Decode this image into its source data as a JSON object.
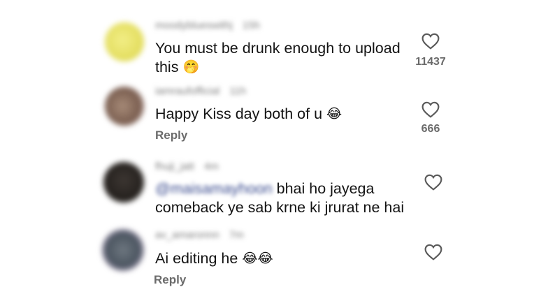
{
  "comments": [
    {
      "username": "moodyblueswithj",
      "age": "15h",
      "text_line1": "You must be drunk enough to upload",
      "text_line2": "this",
      "emoji": "🤭",
      "likes": "11437",
      "avatar_color": "#e8e36a"
    },
    {
      "username": "iamraufofficial",
      "age": "11h",
      "text_line1": "Happy Kiss day both of u",
      "emoji": "😂",
      "reply_label": "Reply",
      "likes": "666",
      "avatar_color": "#8a6f5e"
    },
    {
      "username": "fhuji_jatt",
      "age": "4m",
      "mention": "@maisamayhoon",
      "text_line1": "bhai ho jayega",
      "text_line2": "comeback ye sab krne ki jrurat ne hai",
      "avatar_color": "#2f2a26"
    },
    {
      "username": "av_amaronnn",
      "age": "7m",
      "text_line1": "Ai editing he",
      "emoji": "😂😂",
      "reply_label": "Reply",
      "avatar_color": "#5b6470"
    }
  ],
  "colors": {
    "text": "#141414",
    "meta": "#7d7d7d",
    "mention": "#3b4c8f",
    "heart_stroke": "#5a5a5a"
  },
  "icons": {
    "like": "heart-icon"
  }
}
